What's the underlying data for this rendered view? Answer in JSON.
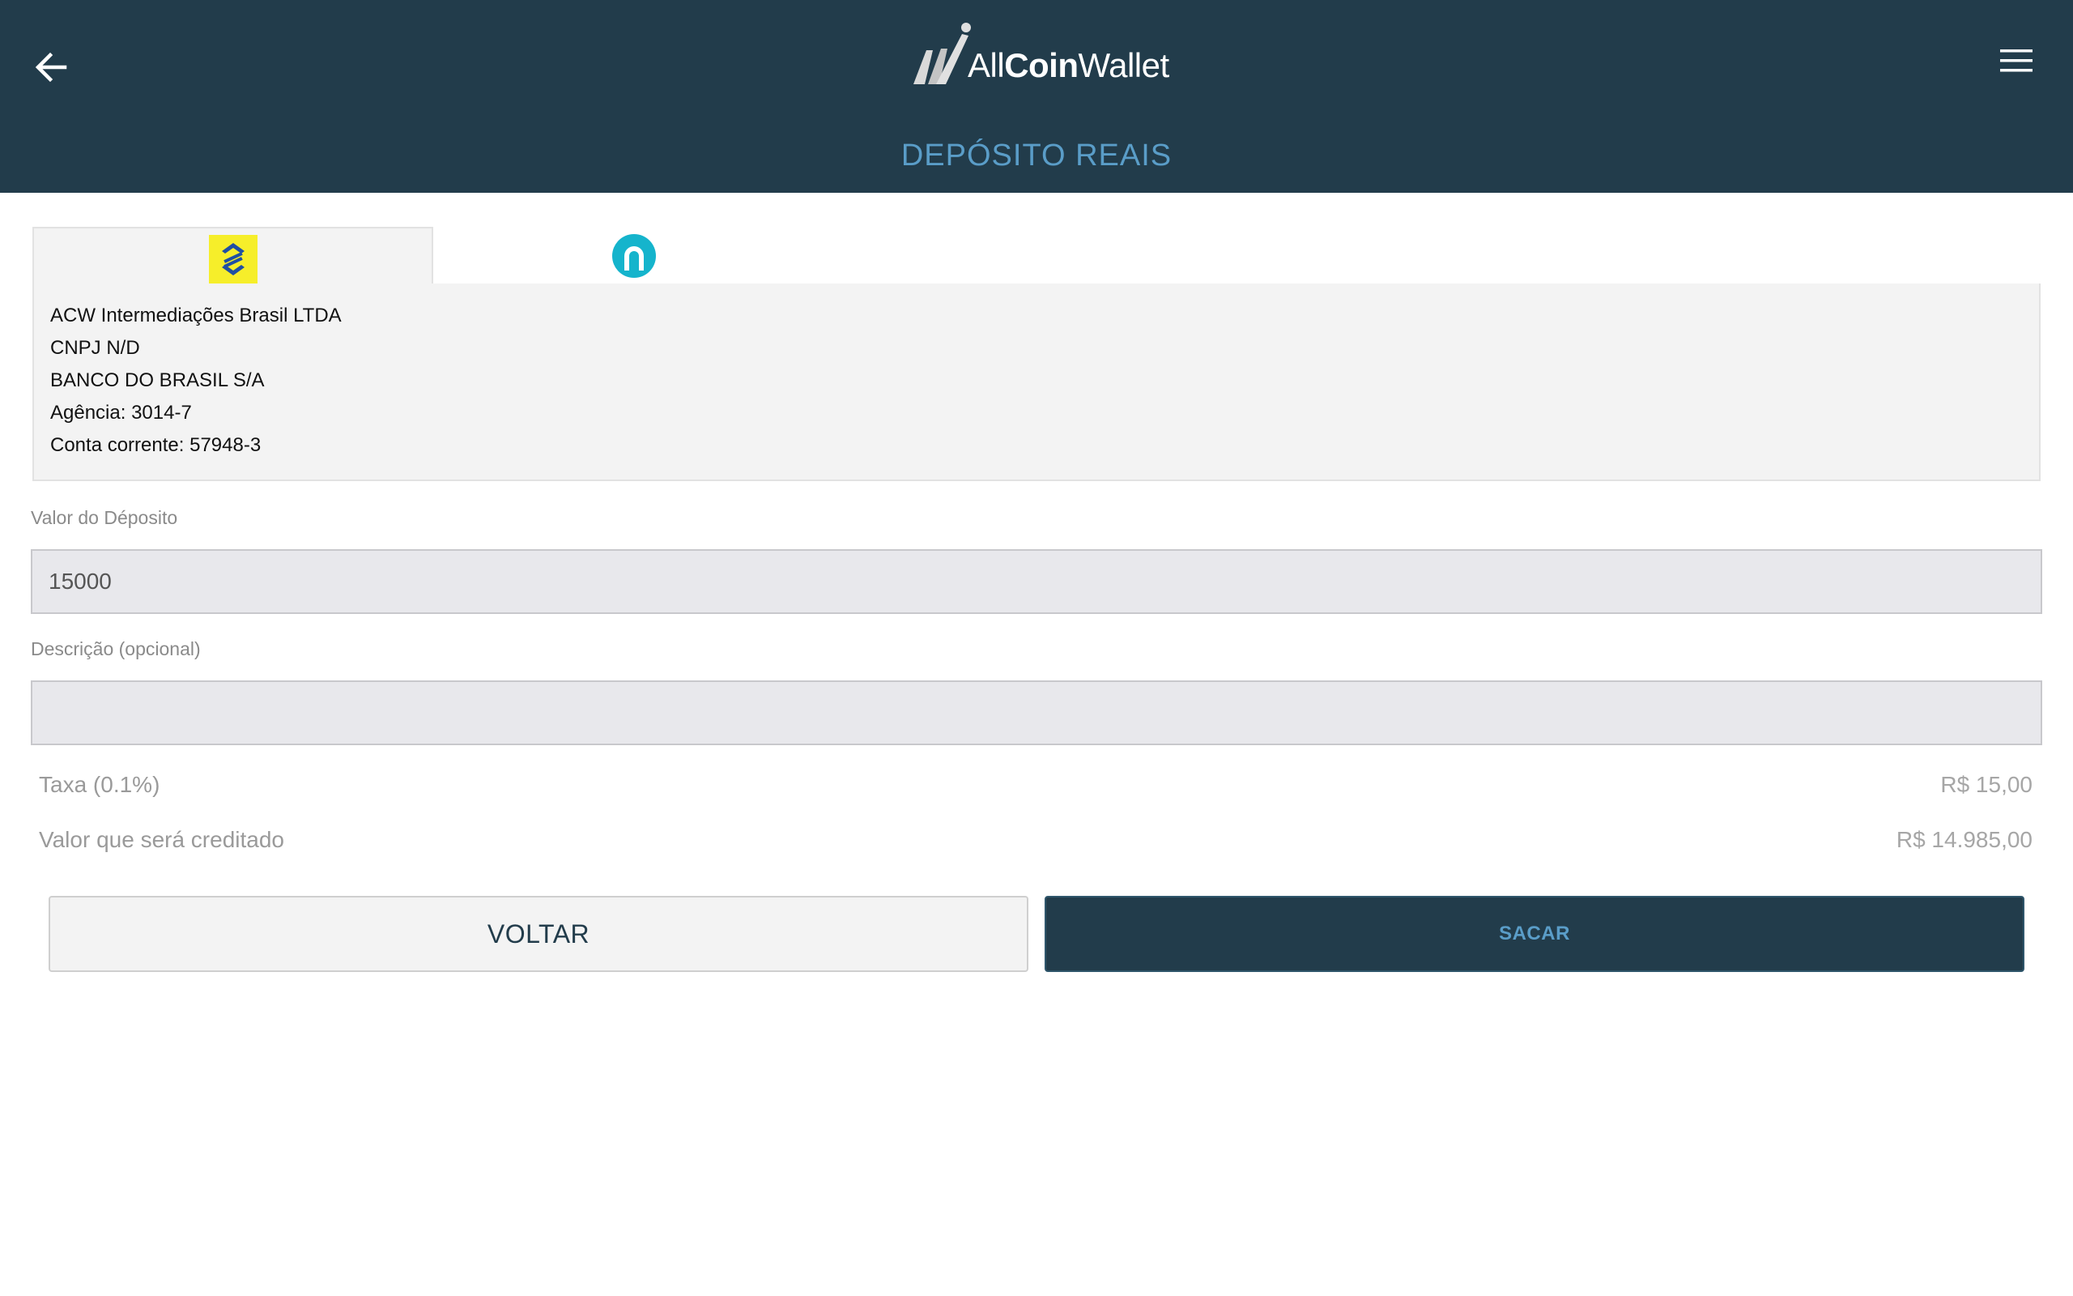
{
  "header": {
    "logo_text_light_1": "All",
    "logo_text_bold": "Coin",
    "logo_text_light_2": "Wallet",
    "title": "DEPÓSITO REAIS",
    "background": "#223c4b",
    "accent": "#5a9dc8"
  },
  "icons": {
    "back": "arrow-left-icon",
    "menu": "hamburger-menu-icon",
    "tab_1": "banco-do-brasil-icon",
    "tab_2": "bank-logo-icon"
  },
  "bank_info": {
    "lines": [
      "ACW Intermediações Brasil LTDA",
      "CNPJ N/D",
      "BANCO DO BRASIL S/A",
      "Agência: 3014-7",
      "Conta corrente: 57948-3"
    ]
  },
  "form": {
    "amount_label": "Valor do Déposito",
    "amount_value": "15000",
    "description_label": "Descrição (opcional)",
    "description_value": ""
  },
  "summary": {
    "fee_label": "Taxa (0.1%)",
    "fee_value": "R$ 15,00",
    "credit_label": "Valor que será creditado",
    "credit_value": "R$ 14.985,00"
  },
  "buttons": {
    "back_label": "VOLTAR",
    "withdraw_label": "SACAR"
  }
}
